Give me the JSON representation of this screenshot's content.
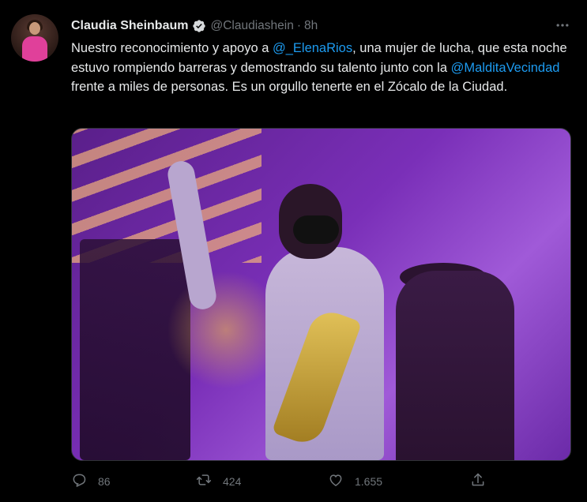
{
  "author": {
    "name": "Claudia Sheinbaum",
    "handle": "@Claudiashein",
    "separator": "·",
    "time": "8h",
    "verified": true
  },
  "tweet": {
    "text_before": "Nuestro reconocimiento y apoyo a ",
    "mention_1": "@_ElenaRios",
    "text_middle": ", una mujer de lucha, que esta noche estuvo rompiendo barreras y demostrando su talento junto con la ",
    "mention_2": "@MalditaVecindad",
    "text_after": " frente a miles de personas. Es un orgullo tenerte en el Zócalo de la Ciudad."
  },
  "actions": {
    "reply_count": "86",
    "retweet_count": "424",
    "like_count": "1.655"
  },
  "icons": {
    "verified": "verified-badge-icon",
    "more": "more-icon",
    "reply": "reply-icon",
    "retweet": "retweet-icon",
    "like": "heart-icon",
    "share": "share-icon"
  },
  "colors": {
    "background": "#000000",
    "text": "#e7e9ea",
    "secondary": "#71767b",
    "link": "#1d9bf0"
  }
}
